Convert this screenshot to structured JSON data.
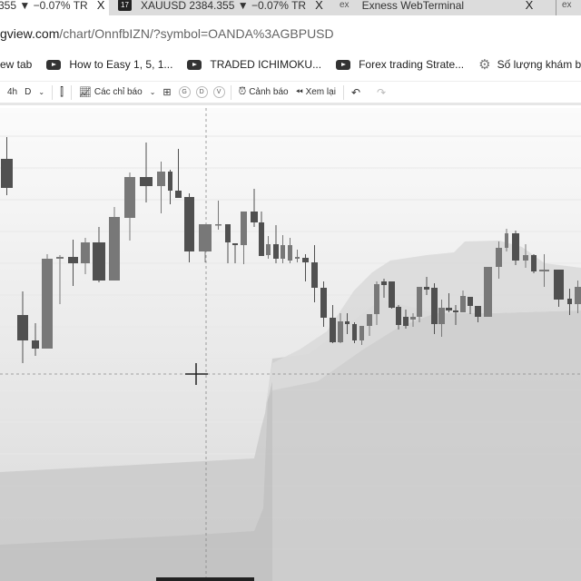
{
  "tabs": [
    {
      "label": "355 ▼ −0.07% TR",
      "close": "X",
      "active": true
    },
    {
      "label": "XAUUSD 2384.355 ▼ −0.07% TR",
      "close": "X",
      "active": false
    },
    {
      "label": "Exness WebTerminal",
      "close": "X",
      "active": false
    }
  ],
  "address": {
    "domain": "gview.com",
    "path": "/chart/OnnfbIZN/?symbol=OANDA%3AGBPUSD"
  },
  "bookmarks": [
    "ew tab",
    "How to Easy 1, 5, 1...",
    "TRADED ICHIMOKU...",
    "Forex trading Strate...",
    "Số lượng khám bện..."
  ],
  "toolbar": {
    "interval_4h": "4h",
    "interval_d": "D",
    "indicators": "Các chỉ báo",
    "circle_g": "G",
    "circle_d": "D",
    "circle_v": "V",
    "alerts": "Cảnh báo",
    "replay": "Xem lại"
  },
  "chart": {
    "symbol": "OANDA:GBPUSD",
    "indicator": "Ichimoku cloud",
    "colors": {
      "bull": "#787878",
      "bear": "#505050",
      "cloud": "#d6d6d6"
    }
  }
}
